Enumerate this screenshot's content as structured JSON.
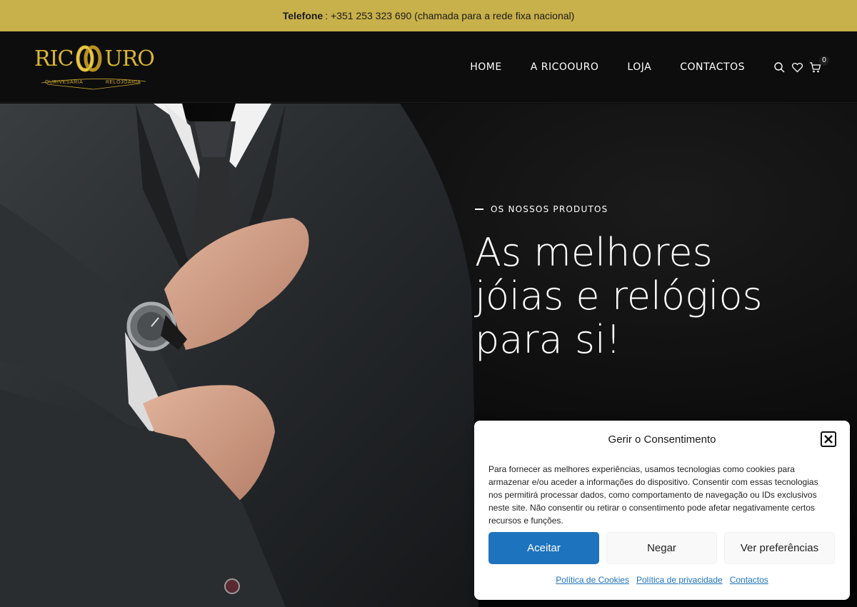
{
  "topbar": {
    "phone_label": "Telefone",
    "phone_text": ": +351 253 323 690 (chamada para a rede fixa nacional)"
  },
  "header": {
    "logo": {
      "word_left": "RIC",
      "word_right": "URO",
      "sub_left": "OURIVESARIA",
      "sub_right": "RELOJOARIA",
      "gold": "#d9b632"
    },
    "nav": [
      {
        "label": "HOME"
      },
      {
        "label": "A RICOOURO"
      },
      {
        "label": "LOJA"
      },
      {
        "label": "CONTACTOS"
      }
    ],
    "icons": {
      "search": "search-icon",
      "wishlist": "heart-icon",
      "cart": "cart-icon"
    },
    "cart_count": "0"
  },
  "hero": {
    "eyebrow": "OS NOSSOS PRODUTOS",
    "title": "As melhores jóias e relógios para si!"
  },
  "consent": {
    "title": "Gerir o Consentimento",
    "text": "Para fornecer as melhores experiências, usamos tecnologias como cookies para armazenar e/ou aceder a informações do dispositivo. Consentir com essas tecnologias nos permitirá processar dados, como comportamento de navegação ou IDs exclusivos neste site. Não consentir ou retirar o consentimento pode afetar negativamente certos recursos e funções.",
    "buttons": {
      "accept": "Aceitar",
      "deny": "Negar",
      "preferences": "Ver preferências"
    },
    "links": {
      "cookies": "Política de Cookies",
      "privacy": "Política de privacidade",
      "contacts": "Contactos"
    },
    "accent": "#1e73be"
  },
  "colors": {
    "topbar": "#c8b04a",
    "header": "#0d0d0d"
  }
}
